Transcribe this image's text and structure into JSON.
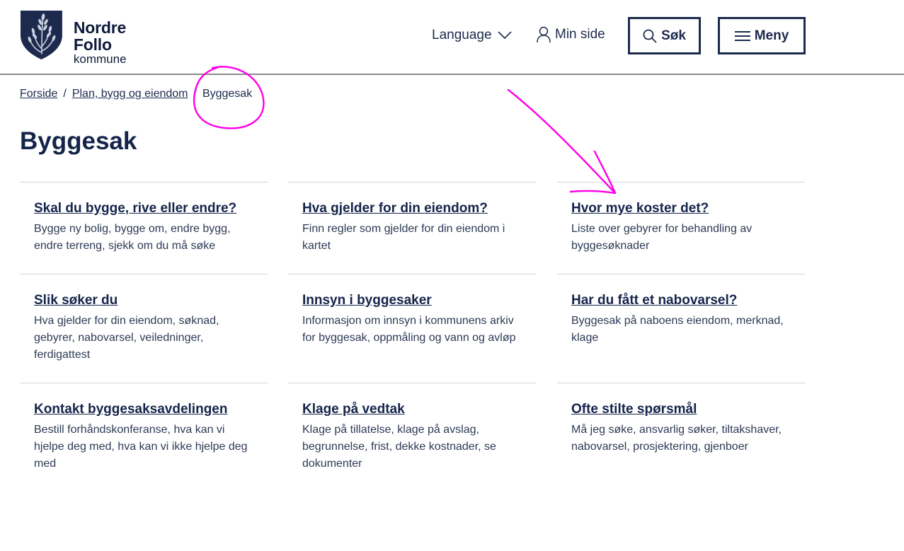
{
  "header": {
    "logo_name": "Nordre Follo",
    "logo_sub": "kommune",
    "language_label": "Language",
    "minside_label": "Min side",
    "search_label": "Søk",
    "menu_label": "Meny"
  },
  "breadcrumb": [
    {
      "label": "Forside"
    },
    {
      "label": "Plan, bygg og eiendom"
    },
    {
      "label": "Byggesak"
    }
  ],
  "breadcrumb_sep": "/",
  "page_title": "Byggesak",
  "cards": [
    {
      "title": "Skal du bygge, rive eller endre?",
      "desc": "Bygge ny bolig, bygge om, endre bygg, endre terreng, sjekk om du må søke"
    },
    {
      "title": "Hva gjelder for din eiendom?",
      "desc": "Finn regler som gjelder for din eiendom i kartet"
    },
    {
      "title": "Hvor mye koster det?",
      "desc": "Liste over gebyrer for behandling av byggesøknader"
    },
    {
      "title": "Slik søker du",
      "desc": "Hva gjelder for din eiendom, søknad, gebyrer, nabovarsel, veiledninger, ferdigattest"
    },
    {
      "title": "Innsyn i byggesaker",
      "desc": "Informasjon om innsyn i kommunens arkiv for byggesak, oppmåling og vann og avløp"
    },
    {
      "title": "Har du fått et nabovarsel?",
      "desc": "Byggesak på naboens eiendom, merknad, klage"
    },
    {
      "title": "Kontakt byggesaksavdelingen",
      "desc": "Bestill forhåndskonferanse, hva kan vi hjelpe deg med, hva kan vi ikke hjelpe deg med"
    },
    {
      "title": "Klage på vedtak",
      "desc": "Klage på tillatelse, klage på avslag, begrunnelse, frist, dekke kostnader, se dokumenter"
    },
    {
      "title": "Ofte stilte spørsmål",
      "desc": "Må jeg søke, ansvarlig søker, tiltakshaver, nabovarsel, prosjektering, gjenboer"
    }
  ],
  "colors": {
    "primary": "#14244a",
    "text": "#1d2a4d",
    "annotation": "#ff00e6",
    "divider": "#d5d5d5"
  },
  "icons": {
    "logo": "coat-of-arms-icon",
    "language": "chevron-down-icon",
    "minside": "user-icon",
    "search": "search-icon",
    "menu": "hamburger-icon"
  }
}
